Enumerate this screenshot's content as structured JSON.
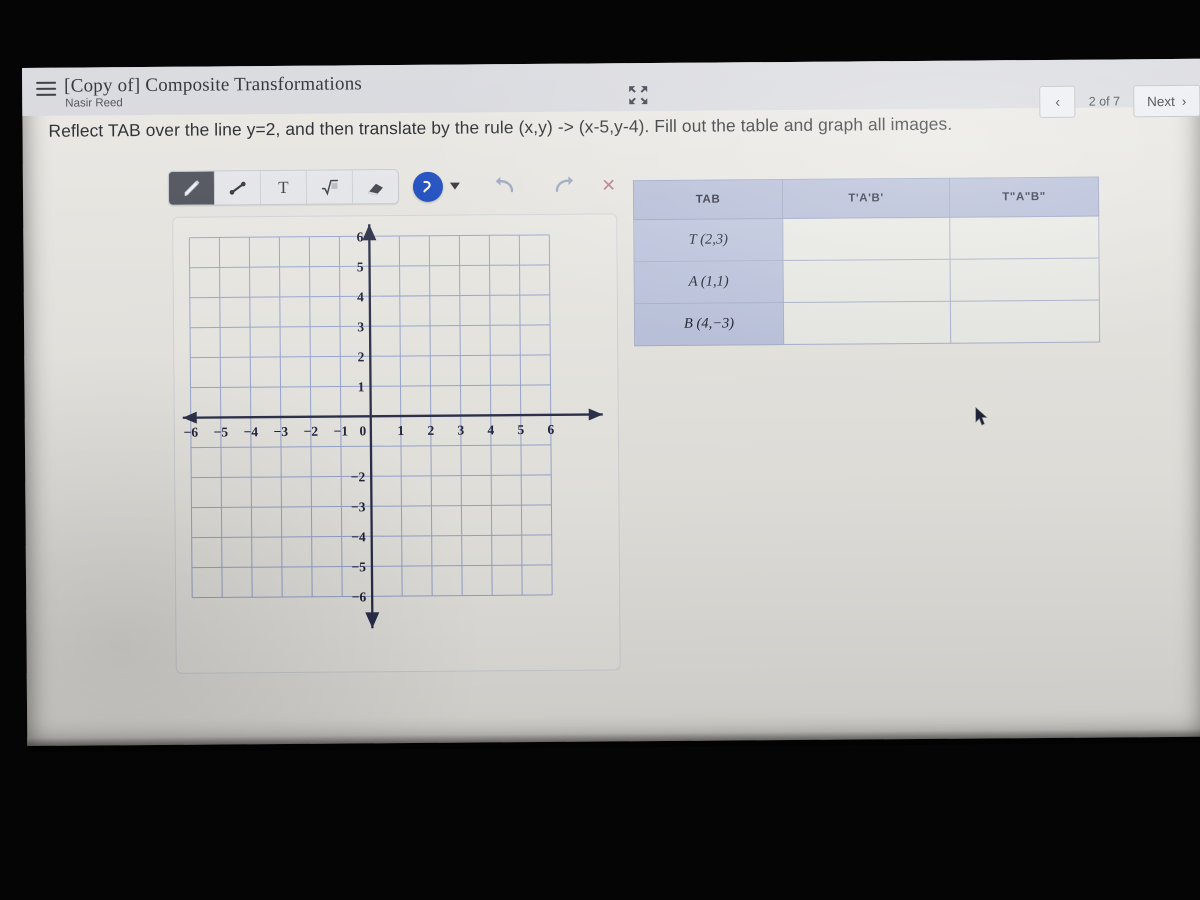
{
  "header": {
    "menu_icon": "hamburger-menu-icon",
    "doc_title": "[Copy of] Composite Transformations",
    "owner": "Nasir Reed",
    "collapse_icon": "collapse-arrows-icon",
    "pager": {
      "back_label": "‹",
      "count": "2 of 7",
      "next_label": "Next",
      "next_chevron": "›"
    }
  },
  "prompt": "Reflect TAB over the line y=2, and then translate by the rule (x,y) -> (x-5,y-4). Fill out the table and graph all images.",
  "toolbar": {
    "tools": [
      {
        "name": "pencil-tool",
        "icon": "pencil-icon",
        "label": "",
        "selected": true
      },
      {
        "name": "line-tool",
        "icon": "line-segment-icon",
        "label": "",
        "selected": false
      },
      {
        "name": "text-tool",
        "icon": "text-icon",
        "label": "T",
        "selected": false
      },
      {
        "name": "equation-tool",
        "icon": "radical-icon",
        "label": "",
        "selected": false
      },
      {
        "name": "eraser-tool",
        "icon": "eraser-icon",
        "label": "",
        "selected": false
      }
    ],
    "pen_button": {
      "name": "ink-color-button",
      "icon": "squiggle-icon",
      "color": "#1848c0"
    },
    "dropdown_icon": "chevron-down-icon",
    "undo": {
      "name": "undo-button",
      "icon": "undo-arrow-icon"
    },
    "redo": {
      "name": "redo-button",
      "icon": "redo-arrow-icon"
    },
    "clear": {
      "name": "clear-button",
      "icon": "close-x-icon",
      "label": "×",
      "color": "#b5757f"
    }
  },
  "graph": {
    "x_labels": [
      "−6",
      "−5",
      "−4",
      "−3",
      "−2",
      "−1",
      "0",
      "1",
      "2",
      "3",
      "4",
      "5",
      "6"
    ],
    "y_labels_up": [
      "1",
      "2",
      "3",
      "4",
      "5",
      "6"
    ],
    "y_labels_down": [
      "−2",
      "−3",
      "−4",
      "−5",
      "−6"
    ],
    "grid_color": "#8d9ccd",
    "axis_color": "#2b2f4a",
    "x_range": [
      -6,
      6
    ],
    "y_range": [
      -6,
      6
    ],
    "grid": true
  },
  "table": {
    "headers": [
      "TAB",
      "T'A'B'",
      "T\"A\"B\""
    ],
    "rows": [
      {
        "key": "T (2,3)",
        "col2": "",
        "col3": ""
      },
      {
        "key": "A (1,1)",
        "col2": "",
        "col3": ""
      },
      {
        "key": "B (4,−3)",
        "col2": "",
        "col3": ""
      }
    ]
  },
  "cursor": {
    "name": "mouse-pointer",
    "icon": "arrow-cursor-icon"
  }
}
